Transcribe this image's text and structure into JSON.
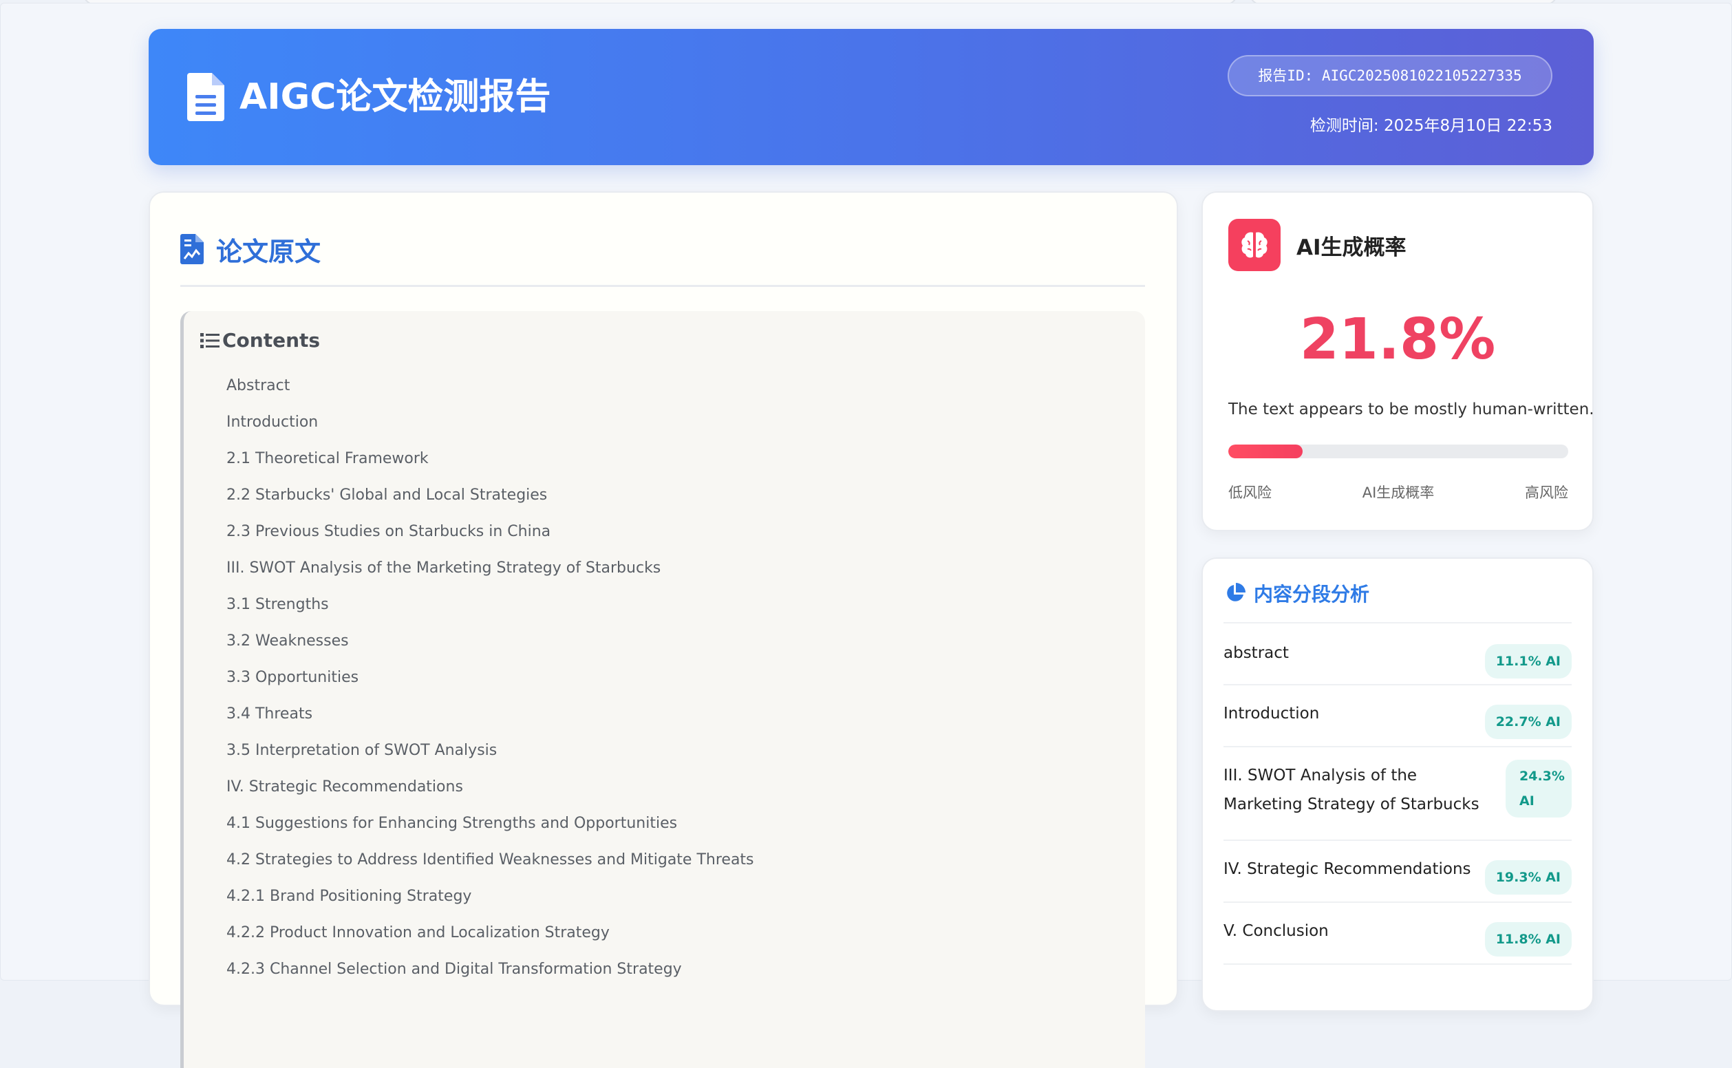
{
  "header": {
    "title": "AIGC论文检测报告",
    "report_id": "报告ID: AIGC2025081022105227335",
    "detect_time": "检测时间: 2025年8月10日 22:53"
  },
  "paper": {
    "heading": "论文原文",
    "toc_title": "Contents",
    "toc_items": [
      "Abstract",
      "Introduction",
      "2.1 Theoretical Framework",
      "2.2 Starbucks' Global and Local Strategies",
      "2.3 Previous Studies on Starbucks in China",
      "III. SWOT Analysis of the Marketing Strategy of Starbucks",
      "3.1 Strengths",
      "3.2 Weaknesses",
      "3.3 Opportunities",
      "3.4 Threats",
      "3.5 Interpretation of SWOT Analysis",
      "IV. Strategic Recommendations",
      "4.1 Suggestions for Enhancing Strengths and Opportunities",
      "4.2 Strategies to Address Identified Weaknesses and Mitigate Threats",
      "4.2.1 Brand Positioning Strategy",
      "4.2.2 Product Innovation and Localization Strategy",
      "4.2.3 Channel Selection and Digital Transformation Strategy"
    ]
  },
  "ai_probability": {
    "title": "AI生成概率",
    "value_text": "21.8%",
    "value": 21.8,
    "description": "The text appears to be mostly human-written.",
    "low_label": "低风险",
    "mid_label": "AI生成概率",
    "high_label": "高风险"
  },
  "segments": {
    "heading": "内容分段分析",
    "items": [
      {
        "name": "abstract",
        "badge": "11.1% AI"
      },
      {
        "name": "Introduction",
        "badge": "22.7% AI"
      },
      {
        "name": "III. SWOT Analysis of the Marketing Strategy of Starbucks",
        "badge": "24.3% AI"
      },
      {
        "name": "IV. Strategic Recommendations",
        "badge": "19.3% AI"
      },
      {
        "name": "V. Conclusion",
        "badge": "11.8% AI"
      }
    ]
  },
  "colors": {
    "header_gradient_start": "#3e87f8",
    "header_gradient_end": "#5c5fd6",
    "ai_accent": "#ef4262",
    "paper_heading": "#2f6fd8",
    "segment_heading": "#2f7be6",
    "badge_bg": "#e6f7f5",
    "badge_text": "#12998a"
  },
  "icons": {
    "header": "document-icon",
    "paper": "file-chart-icon",
    "toc": "list-icon",
    "ai": "brain-icon",
    "segments": "pie-chart-icon"
  }
}
